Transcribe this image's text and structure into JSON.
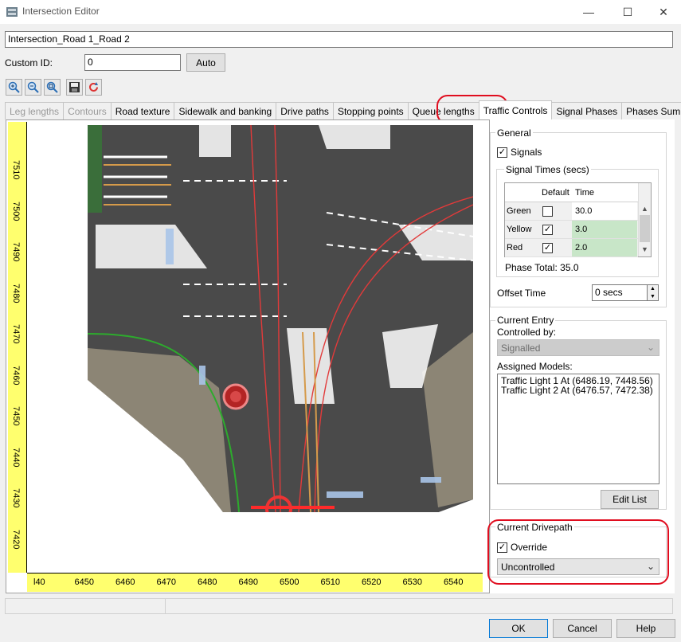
{
  "window": {
    "title": "Intersection Editor"
  },
  "name_field": {
    "value": "Intersection_Road 1_Road 2"
  },
  "custom_id": {
    "label": "Custom ID:",
    "value": "0",
    "auto_label": "Auto"
  },
  "tools": [
    "zoom-in-icon",
    "zoom-out-icon",
    "zoom-fit-icon",
    "save-icon",
    "refresh-icon"
  ],
  "tabs": [
    {
      "label": "Leg lengths",
      "state": "disabled"
    },
    {
      "label": "Contours",
      "state": "disabled"
    },
    {
      "label": "Road texture",
      "state": "normal"
    },
    {
      "label": "Sidewalk and banking",
      "state": "normal"
    },
    {
      "label": "Drive paths",
      "state": "normal"
    },
    {
      "label": "Stopping points",
      "state": "normal"
    },
    {
      "label": "Queue lengths",
      "state": "normal"
    },
    {
      "label": "Traffic Controls",
      "state": "active"
    },
    {
      "label": "Signal Phases",
      "state": "normal"
    },
    {
      "label": "Phases Summary",
      "state": "normal"
    }
  ],
  "ruler": {
    "vertical": [
      "7510",
      "7500",
      "7490",
      "7480",
      "7470",
      "7460",
      "7450",
      "7440",
      "7430",
      "7420"
    ],
    "horizontal": [
      "l40",
      "6450",
      "6460",
      "6470",
      "6480",
      "6490",
      "6500",
      "6510",
      "6520",
      "6530",
      "6540"
    ]
  },
  "general": {
    "title": "General",
    "signals_label": "Signals",
    "signals_checked": true,
    "signal_times_title": "Signal Times (secs)",
    "headers": {
      "default": "Default",
      "time": "Time"
    },
    "rows": [
      {
        "name": "Green",
        "default": false,
        "time": "30.0"
      },
      {
        "name": "Yellow",
        "default": true,
        "time": "3.0"
      },
      {
        "name": "Red",
        "default": true,
        "time": "2.0"
      }
    ],
    "phase_total": "Phase Total: 35.0",
    "offset_label": "Offset Time",
    "offset_value": "0 secs"
  },
  "current_entry": {
    "title": "Current Entry",
    "controlled_by_label": "Controlled by:",
    "controlled_by_value": "Signalled",
    "assigned_models_label": "Assigned Models:",
    "models": [
      "Traffic Light 1 At (6486.19, 7448.56)",
      "Traffic Light 2 At (6476.57, 7472.38)"
    ],
    "edit_list_label": "Edit List"
  },
  "current_drivepath": {
    "title": "Current Drivepath",
    "override_label": "Override",
    "override_checked": true,
    "mode_value": "Uncontrolled"
  },
  "footer": {
    "ok": "OK",
    "cancel": "Cancel",
    "help": "Help"
  },
  "colors": {
    "highlight": "#e00d1f",
    "ruler": "#ffff6e",
    "road": "#4a4a4a",
    "sidewalk": "#8c8575",
    "selected_cell": "#c8e6c8"
  }
}
